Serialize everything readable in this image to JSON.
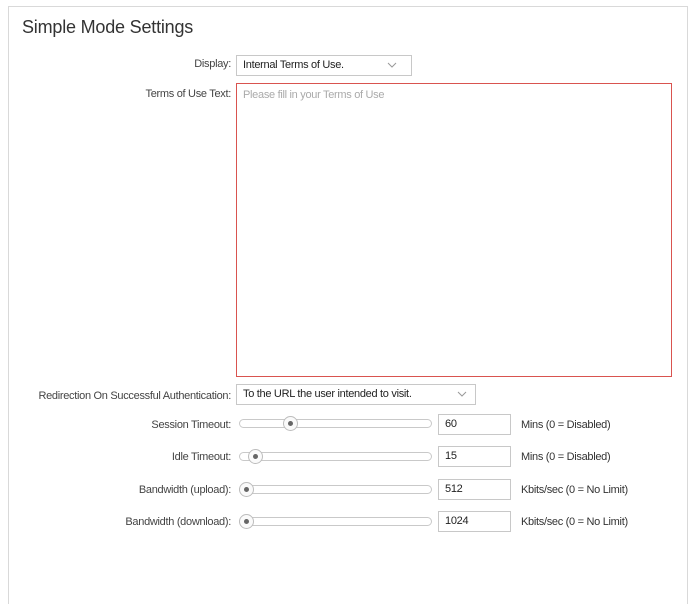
{
  "title": "Simple Mode Settings",
  "display": {
    "label": "Display:",
    "value": "Internal Terms of Use.",
    "icon": "chevron-down-icon"
  },
  "terms": {
    "label": "Terms of Use Text:",
    "placeholder": "Please fill in your Terms of Use",
    "value": ""
  },
  "redirection": {
    "label": "Redirection On Successful Authentication:",
    "value": "To the URL the user intended to visit.",
    "icon": "chevron-down-icon"
  },
  "session_timeout": {
    "label": "Session Timeout:",
    "value": "60",
    "unit": "Mins (0 = Disabled)"
  },
  "idle_timeout": {
    "label": "Idle Timeout:",
    "value": "15",
    "unit": "Mins (0 = Disabled)"
  },
  "bandwidth_upload": {
    "label": "Bandwidth (upload):",
    "value": "512",
    "unit": "Kbits/sec (0 = No Limit)"
  },
  "bandwidth_download": {
    "label": "Bandwidth (download):",
    "value": "1024",
    "unit": "Kbits/sec (0 = No Limit)"
  },
  "colors": {
    "border": "#d9d9d9",
    "error_border": "#d9534f",
    "text": "#333333"
  }
}
